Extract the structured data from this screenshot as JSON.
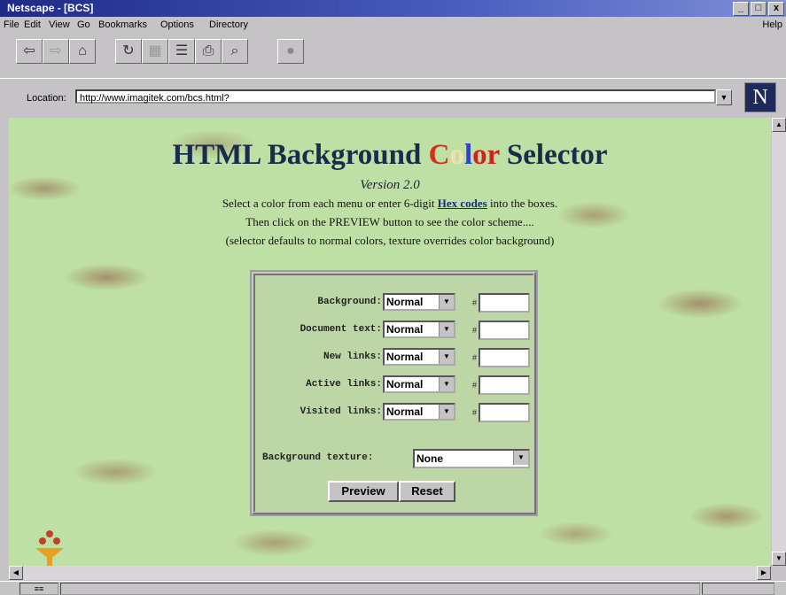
{
  "window": {
    "title": "Netscape - [BCS]"
  },
  "titlebar_buttons": [
    "_",
    "□",
    "x"
  ],
  "menu": [
    "File",
    "Edit",
    "View",
    "Go",
    "Bookmarks",
    "Options",
    "Directory"
  ],
  "menu_help": "Help",
  "toolbar_icons": [
    "back-icon",
    "forward-icon",
    "home-icon",
    "reload-icon",
    "images-icon",
    "open-icon",
    "print-icon",
    "find-icon",
    "stop-icon"
  ],
  "location": {
    "label": "Location:",
    "url": "http://www.imagitek.com/bcs.html?"
  },
  "page": {
    "title_part1": "HTML Background ",
    "title_c": "C",
    "title_o": "o",
    "title_l": "l",
    "title_or": "or",
    "title_part2": " Selector",
    "version": "Version 2.0",
    "instr1_a": "Select a color from each menu or enter 6-digit ",
    "instr1_link": "Hex codes",
    "instr1_b": " into the boxes.",
    "instr2": "Then click on the PREVIEW button to see the color scheme....",
    "instr3": "(selector defaults to normal colors, texture overrides color background)"
  },
  "form": {
    "rows": [
      {
        "label": "Background:",
        "value": "Normal",
        "hex": ""
      },
      {
        "label": "Document text:",
        "value": "Normal",
        "hex": ""
      },
      {
        "label": "New links:",
        "value": "Normal",
        "hex": ""
      },
      {
        "label": "Active links:",
        "value": "Normal",
        "hex": ""
      },
      {
        "label": "Visited links:",
        "value": "Normal",
        "hex": ""
      }
    ],
    "hash": "#",
    "texture_label": "Background texture:",
    "texture_value": "None",
    "preview": "Preview",
    "reset": "Reset"
  },
  "status": {
    "left": "≡≡"
  },
  "colors": {
    "page_bg": "#bfe0a4",
    "title": "#1a2b4b",
    "link": "#1a2a8a",
    "chrome": "#c6c3c6"
  }
}
